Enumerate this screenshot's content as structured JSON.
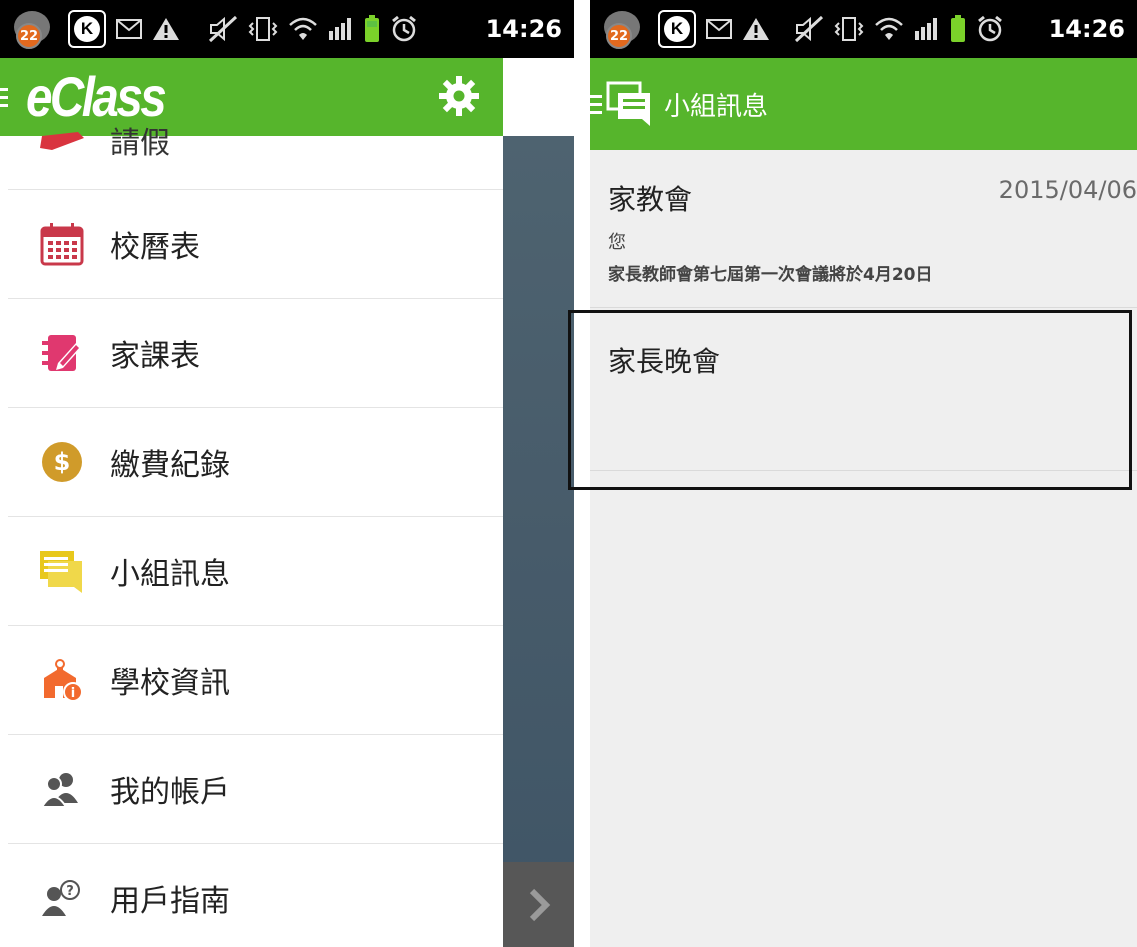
{
  "status_bar": {
    "time": "14:26",
    "badge_count": "22",
    "k_letter": "K",
    "icons": [
      "notification-badge-icon",
      "k-app-icon",
      "mail-icon",
      "warning-icon",
      "mute-icon",
      "vibrate-icon",
      "wifi-icon",
      "signal-icon",
      "battery-icon",
      "alarm-icon"
    ]
  },
  "left": {
    "app_logo": "eClass",
    "partial_item_label": "請假",
    "menu": [
      {
        "label": "校曆表",
        "icon": "calendar-icon",
        "color": "#c9384a"
      },
      {
        "label": "家課表",
        "icon": "homework-icon",
        "color": "#e0386f"
      },
      {
        "label": "繳費紀錄",
        "icon": "dollar-icon",
        "color": "#d09b2a"
      },
      {
        "label": "小組訊息",
        "icon": "group-message-icon",
        "color": "#e6c71e"
      },
      {
        "label": "學校資訊",
        "icon": "school-info-icon",
        "color": "#f26a2e"
      },
      {
        "label": "我的帳戶",
        "icon": "account-icon",
        "color": "#555555"
      },
      {
        "label": "用戶指南",
        "icon": "user-guide-icon",
        "color": "#555555"
      }
    ]
  },
  "right": {
    "title": "小組訊息",
    "messages": [
      {
        "title": "家教會",
        "date": "2015/04/06",
        "sender": "您",
        "preview": "家長教師會第七屆第一次會議將於4月20日"
      },
      {
        "title": "家長晚會",
        "date": "",
        "sender": "",
        "preview": ""
      }
    ]
  },
  "colors": {
    "brand_green": "#56b52c",
    "status_bar": "#000000",
    "list_bg": "#efefef"
  }
}
